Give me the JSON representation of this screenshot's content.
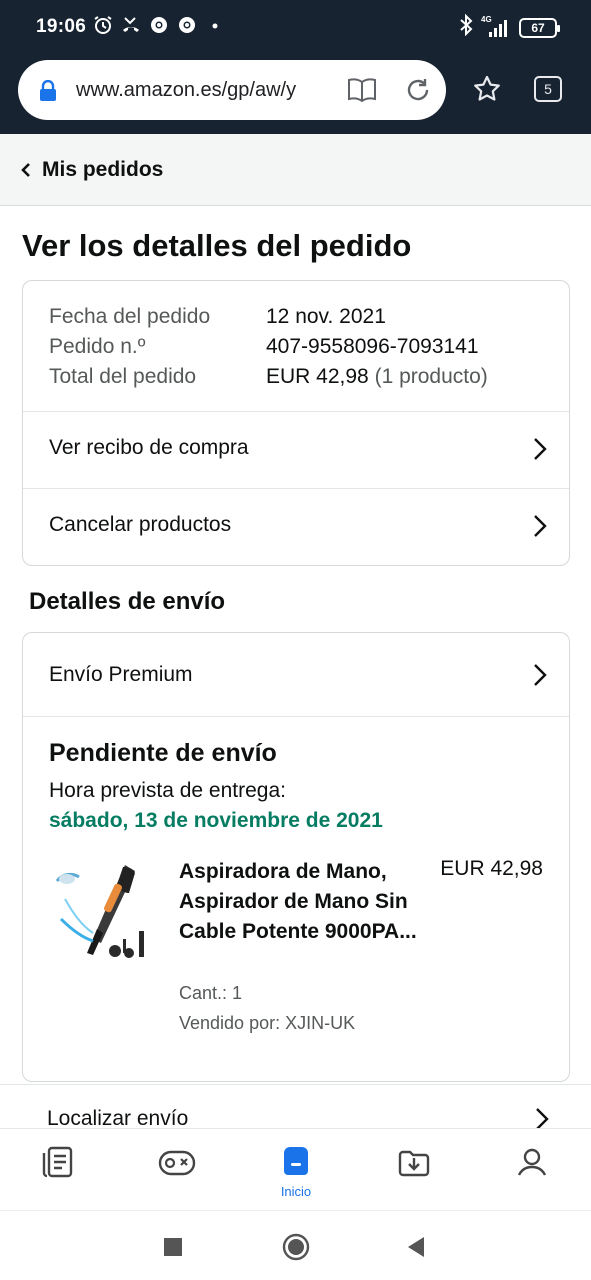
{
  "status_bar": {
    "time": "19:06",
    "network": "4G",
    "battery": "67",
    "icons": [
      "alarm-icon",
      "missed-call-icon",
      "chrome-icon",
      "chrome-icon",
      "dot-icon",
      "bluetooth-icon",
      "signal-icon",
      "battery-icon"
    ]
  },
  "browser": {
    "url": "www.amazon.es/gp/aw/y",
    "tab_count": "5"
  },
  "nav": {
    "back_label": "Mis pedidos"
  },
  "page": {
    "title": "Ver los detalles del pedido"
  },
  "order": {
    "date_label": "Fecha del pedido",
    "date_value": "12 nov. 2021",
    "number_label": "Pedido n.º",
    "number_value": "407-9558096-7093141",
    "total_label": "Total del pedido",
    "total_value": "EUR 42,98",
    "total_count": "(1 producto)",
    "receipt_link": "Ver recibo de compra",
    "cancel_link": "Cancelar productos"
  },
  "shipping": {
    "section_title": "Detalles de envío",
    "method": "Envío Premium",
    "status": "Pendiente de envío",
    "eta_label": "Hora prevista de entrega:",
    "eta_date": "sábado, 13 de noviembre de 2021",
    "locate_link": "Localizar envío"
  },
  "product": {
    "title": "Aspiradora de Mano, Aspirador de Mano Sin Cable Potente 9000PA...",
    "price": "EUR 42,98",
    "quantity": "Cant.: 1",
    "seller": "Vendido por: XJIN-UK"
  },
  "bottom_nav": {
    "home_label": "Inicio"
  },
  "colors": {
    "header_bg": "#172331",
    "eta_green": "#067d62",
    "active_blue": "#1a73e8"
  }
}
